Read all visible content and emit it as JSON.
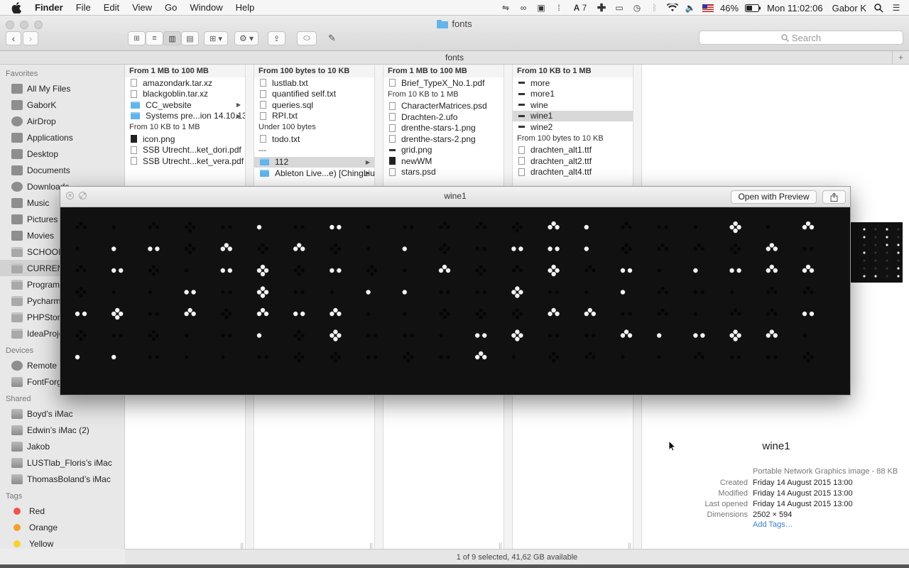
{
  "menubar": {
    "app": "Finder",
    "items": [
      "File",
      "Edit",
      "View",
      "Go",
      "Window",
      "Help"
    ],
    "status": {
      "keyboard_badge": "7",
      "battery": "46%",
      "clock": "Mon 11:02:06",
      "user": "Gabor K"
    }
  },
  "window": {
    "title": "fonts",
    "path_title": "fonts",
    "search_placeholder": "Search"
  },
  "sidebar": {
    "favorites_header": "Favorites",
    "favorites": [
      "All My Files",
      "GaborK",
      "AirDrop",
      "Applications",
      "Desktop",
      "Documents",
      "Downloads",
      "Music",
      "Pictures",
      "Movies",
      "SCHOOL",
      "CURRENT",
      "Programming",
      "Pycharm",
      "PHPStorm",
      "IdeaProjects"
    ],
    "devices_header": "Devices",
    "devices": [
      "Remote Disc",
      "FontForge"
    ],
    "shared_header": "Shared",
    "shared": [
      "Boyd’s iMac",
      "Edwin’s iMac (2)",
      "Jakob",
      "LUSTlab_Floris’s iMac",
      "ThomasBoland’s iMac"
    ],
    "tags_header": "Tags",
    "tags": [
      {
        "name": "Red",
        "color": "#f0524c"
      },
      {
        "name": "Orange",
        "color": "#f5a02c"
      },
      {
        "name": "Yellow",
        "color": "#f6d22c"
      }
    ]
  },
  "columns": [
    {
      "groups": [
        {
          "title": "From 1 MB to 100 MB",
          "files": [
            {
              "name": "amazondark.tar.xz",
              "icon": "doc"
            },
            {
              "name": "blackgoblin.tar.xz",
              "icon": "doc"
            },
            {
              "name": "CC_website",
              "icon": "folder",
              "arrow": true
            },
            {
              "name": "Systems pre...ion 14.10.13.",
              "icon": "folder",
              "arrow": true
            }
          ]
        },
        {
          "title": "From 10 KB to 1 MB",
          "files": [
            {
              "name": "icon.png",
              "icon": "dark"
            },
            {
              "name": "SSB Utrecht...ket_dori.pdf",
              "icon": "doc"
            },
            {
              "name": "SSB Utrecht...ket_vera.pdf",
              "icon": "doc"
            }
          ]
        }
      ]
    },
    {
      "groups": [
        {
          "title": "From 100 bytes to 10 KB",
          "files": [
            {
              "name": "lustlab.txt",
              "icon": "doc"
            },
            {
              "name": "quantified self.txt",
              "icon": "doc"
            },
            {
              "name": "queries.sql",
              "icon": "doc"
            },
            {
              "name": "RPI.txt",
              "icon": "doc"
            }
          ]
        },
        {
          "title": "Under 100 bytes",
          "files": [
            {
              "name": "todo.txt",
              "icon": "doc"
            }
          ]
        },
        {
          "title": "---",
          "files": [
            {
              "name": "112",
              "icon": "folder",
              "arrow": true,
              "selected": true
            },
            {
              "name": "Ableton Live...e) [ChingLiu]",
              "icon": "folder",
              "arrow": true
            }
          ]
        }
      ]
    },
    {
      "groups": [
        {
          "title": "From 1 MB to 100 MB",
          "files": [
            {
              "name": "Brief_TypeX_No.1.pdf",
              "icon": "doc"
            }
          ]
        },
        {
          "title": "From 10 KB to 1 MB",
          "files": [
            {
              "name": "CharacterMatrices.psd",
              "icon": "doc"
            },
            {
              "name": "Drachten-2.ufo",
              "icon": "doc"
            },
            {
              "name": "drenthe-stars-1.png",
              "icon": "doc"
            },
            {
              "name": "drenthe-stars-2.png",
              "icon": "doc"
            },
            {
              "name": "grid.png",
              "icon": "line"
            },
            {
              "name": "newWM",
              "icon": "dark"
            },
            {
              "name": "stars.psd",
              "icon": "doc"
            }
          ]
        }
      ]
    },
    {
      "groups": [
        {
          "title": "From 10 KB to 1 MB",
          "files": [
            {
              "name": "more",
              "icon": "line"
            },
            {
              "name": "more1",
              "icon": "line"
            },
            {
              "name": "wine",
              "icon": "line"
            },
            {
              "name": "wine1",
              "icon": "line",
              "selected": true
            },
            {
              "name": "wine2",
              "icon": "line"
            }
          ]
        },
        {
          "title": "From 100 bytes to 10 KB",
          "files": [
            {
              "name": "drachten_alt1.ttf",
              "icon": "doc"
            },
            {
              "name": "drachten_alt2.ttf",
              "icon": "doc"
            },
            {
              "name": "drachten_alt4.ttf",
              "icon": "doc"
            }
          ]
        }
      ]
    }
  ],
  "preview_info": {
    "name": "wine1",
    "kind": "Portable Network Graphics image - 88 KB",
    "rows": [
      {
        "label": "Created",
        "value": "Friday 14 August 2015 13:00"
      },
      {
        "label": "Modified",
        "value": "Friday 14 August 2015 13:00"
      },
      {
        "label": "Last opened",
        "value": "Friday 14 August 2015 13:00"
      },
      {
        "label": "Dimensions",
        "value": "2502 × 594"
      }
    ],
    "add_tags": "Add Tags…"
  },
  "status_text": "1 of 9 selected, 41,62 GB available",
  "quicklook": {
    "title": "wine1",
    "open_button": "Open with Preview"
  }
}
